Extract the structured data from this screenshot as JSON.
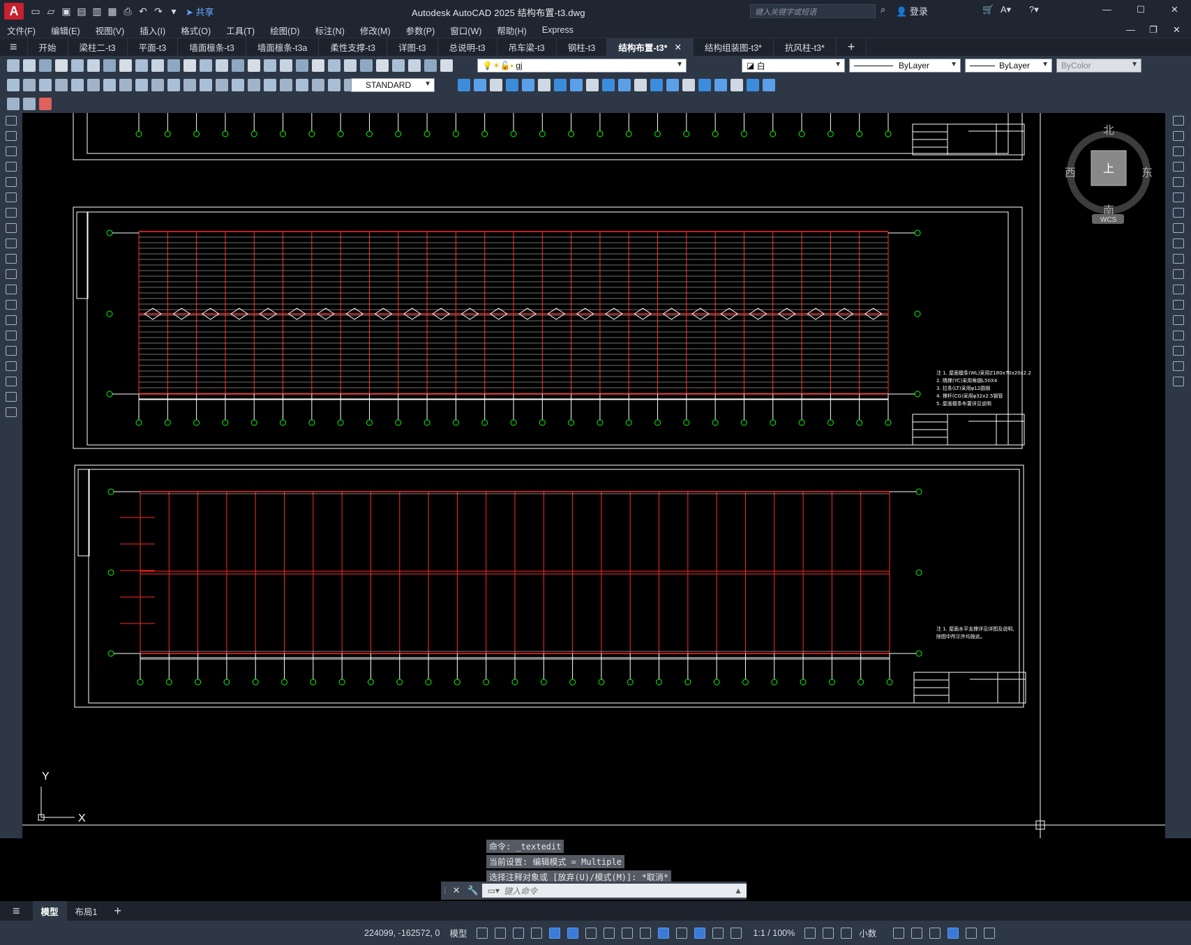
{
  "titlebar": {
    "app_logo": "A",
    "share": "共享",
    "title": "Autodesk AutoCAD 2025    结构布置-t3.dwg",
    "search_placeholder": "键入关键字或短语",
    "login": "登录"
  },
  "menu": [
    "文件(F)",
    "编辑(E)",
    "视图(V)",
    "插入(I)",
    "格式(O)",
    "工具(T)",
    "绘图(D)",
    "标注(N)",
    "修改(M)",
    "参数(P)",
    "窗口(W)",
    "帮助(H)",
    "Express"
  ],
  "tabs": [
    {
      "label": "开始"
    },
    {
      "label": "梁柱二-t3"
    },
    {
      "label": "平面-t3"
    },
    {
      "label": "墙面檩条-t3"
    },
    {
      "label": "墙面檩条-t3a"
    },
    {
      "label": "柔性支撑-t3"
    },
    {
      "label": "详图-t3"
    },
    {
      "label": "总说明-t3"
    },
    {
      "label": "吊车梁-t3"
    },
    {
      "label": "钢柱-t3"
    },
    {
      "label": "结构布置-t3*",
      "active": true
    },
    {
      "label": "结构组装图-t3*"
    },
    {
      "label": "抗风柱-t3*"
    }
  ],
  "layer": {
    "name": "gj",
    "color": "白",
    "linetype": "ByLayer",
    "lineweight": "ByLayer",
    "plotstyle": "ByColor",
    "textstyle": "STANDARD"
  },
  "viewcube": {
    "north": "北",
    "south": "南",
    "east": "东",
    "west": "西",
    "face": "上",
    "wcs": "WCS"
  },
  "ucs": {
    "x": "X",
    "y": "Y"
  },
  "command": {
    "history": [
      "命令: _textedit",
      "当前设置: 编辑模式 = Multiple",
      "选择注释对象或 [放弃(U)/模式(M)]: *取消*"
    ],
    "placeholder": "键入命令"
  },
  "layout_tabs": [
    "模型",
    "布局1"
  ],
  "status": {
    "coords": "224099, -162572, 0",
    "model": "模型",
    "scale": "1:1 / 100%",
    "units": "小数"
  },
  "notes": {
    "sheet2": [
      "注 1. 屋面檩条(WL)采用Z180x70x20x2.2",
      "2. 隅撑(YC)采用角钢L50X4",
      "3. 拉条(LT)采用φ12圆钢",
      "4. 撑杆(CG)采用φ32x2.5钢管",
      "5. 屋面檩条布置详见说明"
    ],
    "sheet3": [
      "注 1. 屋面水平支撑详见详图及说明,",
      "除图中所示外均按此。"
    ]
  }
}
